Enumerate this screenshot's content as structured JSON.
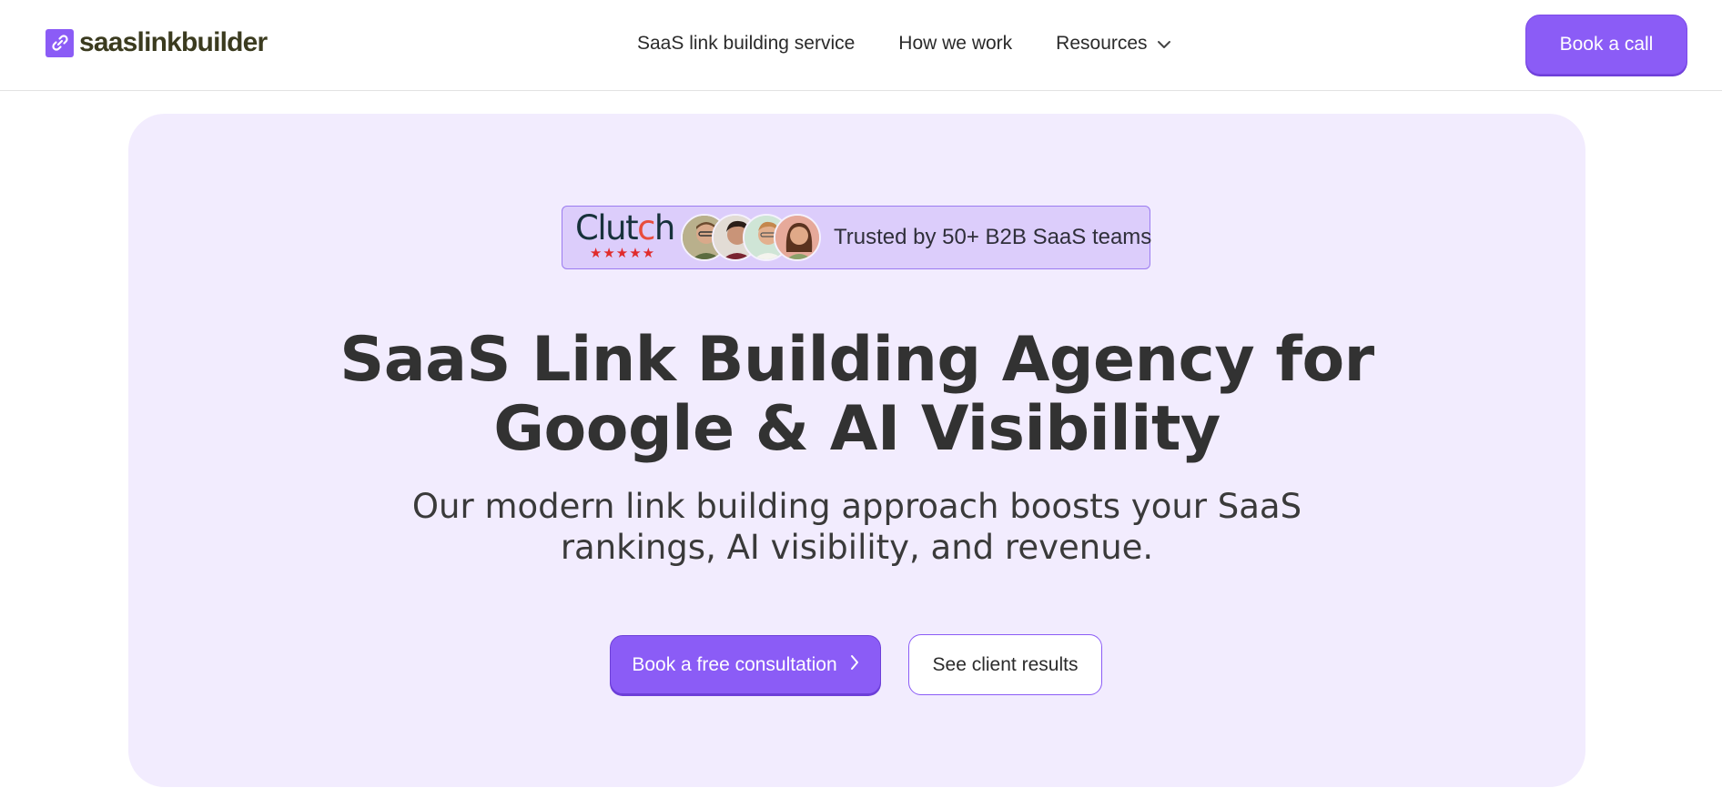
{
  "header": {
    "logo_text": "saaslinkbuilder",
    "nav": [
      {
        "label": "SaaS link building service"
      },
      {
        "label": "How we work"
      },
      {
        "label": "Resources"
      }
    ],
    "cta_label": "Book a call"
  },
  "hero": {
    "badge": {
      "clutch_word_left": "Clut",
      "clutch_word_dot": "c",
      "clutch_word_right": "h",
      "stars": "★★★★★",
      "text": "Trusted by 50+ B2B SaaS teams"
    },
    "headline_line1": "SaaS Link Building Agency for",
    "headline_line2": "Google & AI Visibility",
    "subhead_line1": "Our modern link building approach boosts your SaaS",
    "subhead_line2": "rankings, AI visibility, and revenue.",
    "primary_cta": "Book a free consultation",
    "secondary_cta": "See client results"
  },
  "colors": {
    "accent": "#8b5cf6",
    "hero_bg": "#f2ecfe",
    "badge_bg": "#dccdfb",
    "star": "#e02b2b"
  }
}
